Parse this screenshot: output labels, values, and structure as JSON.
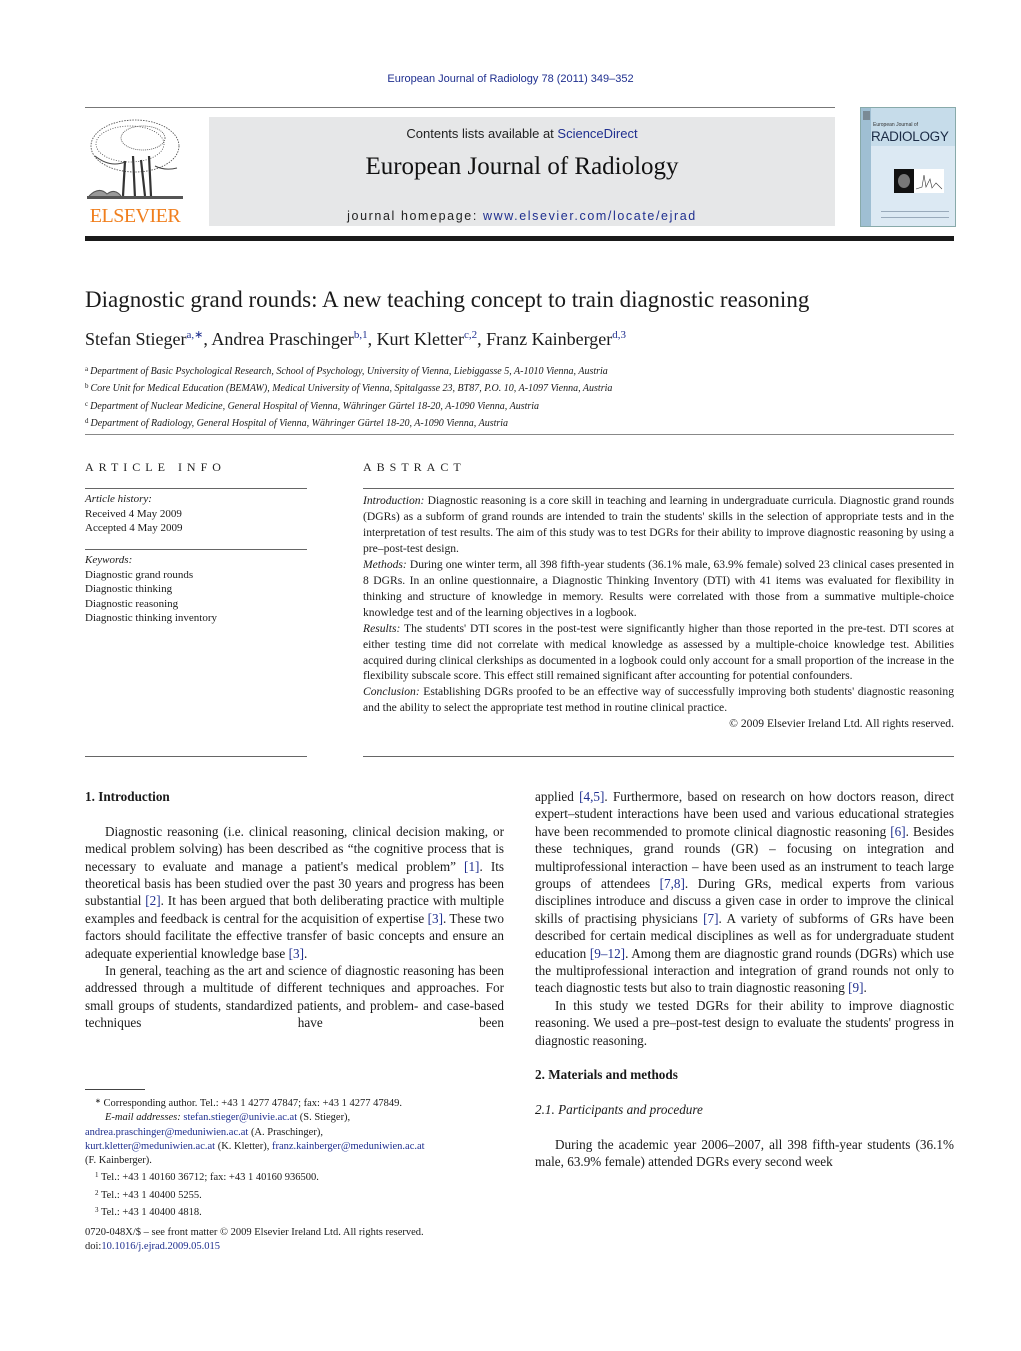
{
  "header": {
    "citation": "European Journal of Radiology 78 (2011) 349–352",
    "contents_prefix": "Contents lists available at ",
    "contents_link": "ScienceDirect",
    "journal_title": "European Journal of Radiology",
    "homepage_prefix": "journal homepage: ",
    "homepage_link": "www.elsevier.com/locate/ejrad",
    "publisher_logo_text": "ELSEVIER",
    "cover": {
      "small_title": "European Journal of",
      "big_title": "RADIOLOGY"
    },
    "colors": {
      "link": "#1f2f8f",
      "elsevier_orange": "#f07f1e",
      "band": "#e6e7e8"
    }
  },
  "article": {
    "title": "Diagnostic grand rounds: A new teaching concept to train diagnostic reasoning",
    "authors": [
      {
        "name": "Stefan Stieger",
        "marks": "a,∗"
      },
      {
        "name": "Andrea Praschinger",
        "marks": "b,1"
      },
      {
        "name": "Kurt Kletter",
        "marks": "c,2"
      },
      {
        "name": "Franz Kainberger",
        "marks": "d,3"
      }
    ],
    "affiliations": [
      {
        "mark": "a",
        "text": "Department of Basic Psychological Research, School of Psychology, University of Vienna, Liebiggasse 5, A-1010 Vienna, Austria"
      },
      {
        "mark": "b",
        "text": "Core Unit for Medical Education (BEMAW), Medical University of Vienna, Spitalgasse 23, BT87, P.O. 10, A-1097 Vienna, Austria"
      },
      {
        "mark": "c",
        "text": "Department of Nuclear Medicine, General Hospital of Vienna, Währinger Gürtel 18-20, A-1090 Vienna, Austria"
      },
      {
        "mark": "d",
        "text": "Department of Radiology, General Hospital of Vienna, Währinger Gürtel 18-20, A-1090 Vienna, Austria"
      }
    ]
  },
  "article_info": {
    "heading": "ARTICLE INFO",
    "history_label": "Article history:",
    "received": "Received 4 May 2009",
    "accepted": "Accepted 4 May 2009",
    "keywords_label": "Keywords:",
    "keywords": [
      "Diagnostic grand rounds",
      "Diagnostic thinking",
      "Diagnostic reasoning",
      "Diagnostic thinking inventory"
    ]
  },
  "abstract": {
    "heading": "ABSTRACT",
    "sections": [
      {
        "label": "Introduction:",
        "text": " Diagnostic reasoning is a core skill in teaching and learning in undergraduate curricula. Diagnostic grand rounds (DGRs) as a subform of grand rounds are intended to train the students' skills in the selection of appropriate tests and in the interpretation of test results. The aim of this study was to test DGRs for their ability to improve diagnostic reasoning by using a pre–post-test design."
      },
      {
        "label": "Methods:",
        "text": " During one winter term, all 398 fifth-year students (36.1% male, 63.9% female) solved 23 clinical cases presented in 8 DGRs. In an online questionnaire, a Diagnostic Thinking Inventory (DTI) with 41 items was evaluated for flexibility in thinking and structure of knowledge in memory. Results were correlated with those from a summative multiple-choice knowledge test and of the learning objectives in a logbook."
      },
      {
        "label": "Results:",
        "text": " The students' DTI scores in the post-test were significantly higher than those reported in the pre-test. DTI scores at either testing time did not correlate with medical knowledge as assessed by a multiple-choice knowledge test. Abilities acquired during clinical clerkships as documented in a logbook could only account for a small proportion of the increase in the flexibility subscale score. This effect still remained significant after accounting for potential confounders."
      },
      {
        "label": "Conclusion:",
        "text": " Establishing DGRs proofed to be an effective way of successfully improving both students' diagnostic reasoning and the ability to select the appropriate test method in routine clinical practice."
      }
    ],
    "copyright": "© 2009 Elsevier Ireland Ltd. All rights reserved."
  },
  "body": {
    "section1_heading": "1.  Introduction",
    "intro_p1": [
      {
        "t": "Diagnostic reasoning (i.e. clinical reasoning, clinical decision making, or medical problem solving) has been described as “the cognitive process that is necessary to evaluate and manage a patient's medical problem” "
      },
      {
        "ref": "[1]"
      },
      {
        "t": ". Its theoretical basis has been studied over the past 30 years and progress has been substantial "
      },
      {
        "ref": "[2]"
      },
      {
        "t": ". It has been argued that both deliberating practice with multiple examples and feedback is central for the acquisition of expertise "
      },
      {
        "ref": "[3]"
      },
      {
        "t": ". These two factors should facilitate the effective transfer of basic concepts and ensure an adequate experiential knowledge base "
      },
      {
        "ref": "[3]"
      },
      {
        "t": "."
      }
    ],
    "intro_p2": [
      {
        "t": "In general, teaching as the art and science of diagnostic reasoning has been addressed through a multitude of different techniques and approaches. For small groups of students, standardized patients, and problem- and case-based techniques have been applied "
      },
      {
        "ref": "[4,5]"
      },
      {
        "t": ". Furthermore, based on research on how doctors reason, direct expert–student interactions have been used and various educational strategies have been recommended to promote clinical diagnostic reasoning "
      },
      {
        "ref": "[6]"
      },
      {
        "t": ". Besides these techniques, grand rounds (GR) – focusing on integration and multiprofessional interaction – have been used as an instrument to teach large groups of attendees "
      },
      {
        "ref": "[7,8]"
      },
      {
        "t": ". During GRs, medical experts from various disciplines introduce and discuss a given case in order to improve the clinical skills of practising physicians "
      },
      {
        "ref": "[7]"
      },
      {
        "t": ". A variety of subforms of GRs have been described for certain medical disciplines as well as for undergraduate student education "
      },
      {
        "ref": "[9–12]"
      },
      {
        "t": ". Among them are diagnostic grand rounds (DGRs) which use the multiprofessional interaction and integration of grand rounds not only to teach diagnostic tests but also to train diagnostic reasoning "
      },
      {
        "ref": "[9]"
      },
      {
        "t": "."
      }
    ],
    "intro_p3": "In this study we tested DGRs for their ability to improve diagnostic reasoning. We used a pre–post-test design to evaluate the students' progress in diagnostic reasoning.",
    "section2_heading": "2.  Materials and methods",
    "subsection21_heading": "2.1.  Participants and procedure",
    "methods_p1": "During the academic year 2006–2007, all 398 fifth-year students (36.1% male, 63.9% female) attended DGRs every second week"
  },
  "footnotes": {
    "corresponding": "Corresponding author. Tel.: +43 1 4277 47847; fax: +43 1 4277 47849.",
    "email_label": "E-mail addresses:",
    "emails": [
      {
        "email": "stefan.stieger@univie.ac.at",
        "who": " (S. Stieger),"
      },
      {
        "email": "andrea.praschinger@meduniwien.ac.at",
        "who": " (A. Praschinger),"
      },
      {
        "email": "kurt.kletter@meduniwien.ac.at",
        "who": " (K. Kletter), "
      },
      {
        "email": "franz.kainberger@meduniwien.ac.at",
        "who": ""
      }
    ],
    "last_who": "(F. Kainberger).",
    "notes": [
      {
        "mark": "1",
        "text": "Tel.: +43 1 40160 36712; fax: +43 1 40160 936500."
      },
      {
        "mark": "2",
        "text": "Tel.: +43 1 40400 5255."
      },
      {
        "mark": "3",
        "text": "Tel.: +43 1 40400 4818."
      }
    ],
    "front_matter": "0720-048X/$ – see front matter © 2009 Elsevier Ireland Ltd. All rights reserved.",
    "doi_prefix": "doi:",
    "doi": "10.1016/j.ejrad.2009.05.015"
  }
}
